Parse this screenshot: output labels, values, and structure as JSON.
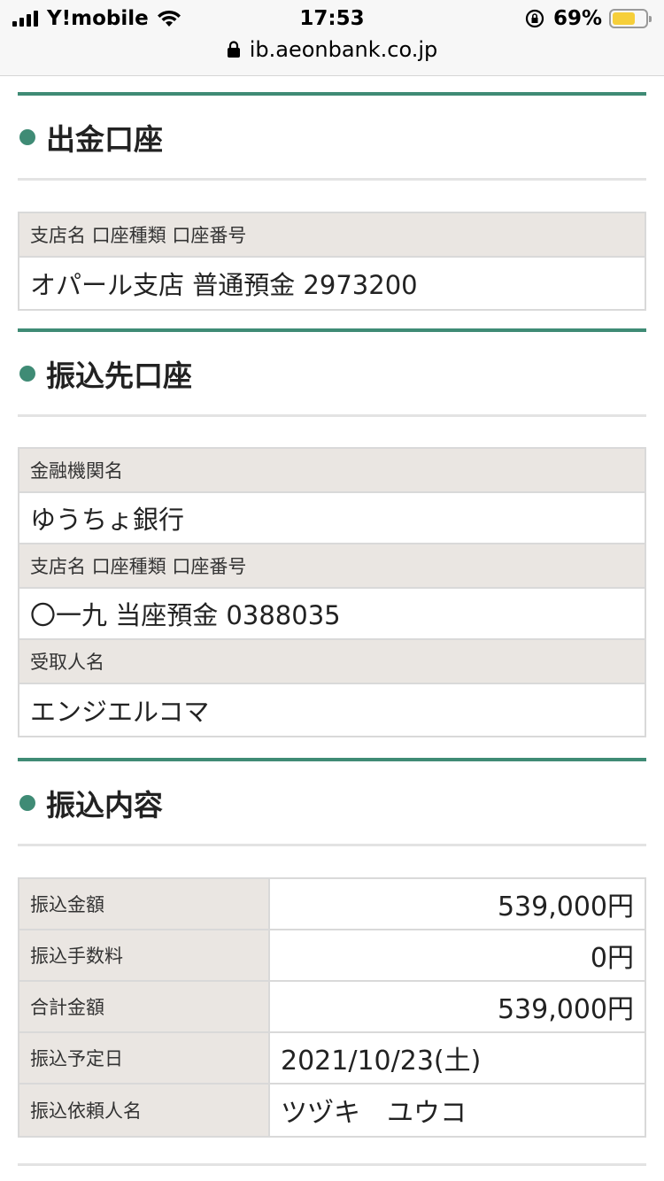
{
  "status_bar": {
    "carrier": "Y!mobile",
    "time": "17:53",
    "battery_percent": "69%",
    "battery_level": 0.69,
    "battery_color": "#f6cf3a",
    "url": "ib.aeonbank.co.jp"
  },
  "colors": {
    "accent": "#3f8b75",
    "label_bg": "#eae6e2"
  },
  "source_account": {
    "title": "出金口座",
    "label": "支店名 口座種類 口座番号",
    "value": "オパール支店 普通預金 2973200"
  },
  "destination_account": {
    "title": "振込先口座",
    "bank_label": "金融機関名",
    "bank_value": "ゆうちょ銀行",
    "branch_label": "支店名 口座種類 口座番号",
    "branch_value": "〇一九 当座預金 0388035",
    "recipient_label": "受取人名",
    "recipient_value": "エンジエルコマ"
  },
  "transfer_details": {
    "title": "振込内容",
    "rows": [
      {
        "label": "振込金額",
        "value": "539,000円"
      },
      {
        "label": "振込手数料",
        "value": "0円"
      },
      {
        "label": "合計金額",
        "value": "539,000円"
      },
      {
        "label": "振込予定日",
        "value": "2021/10/23(土)"
      },
      {
        "label": "振込依頼人名",
        "value": "ツヅキ　ユウコ"
      }
    ]
  }
}
